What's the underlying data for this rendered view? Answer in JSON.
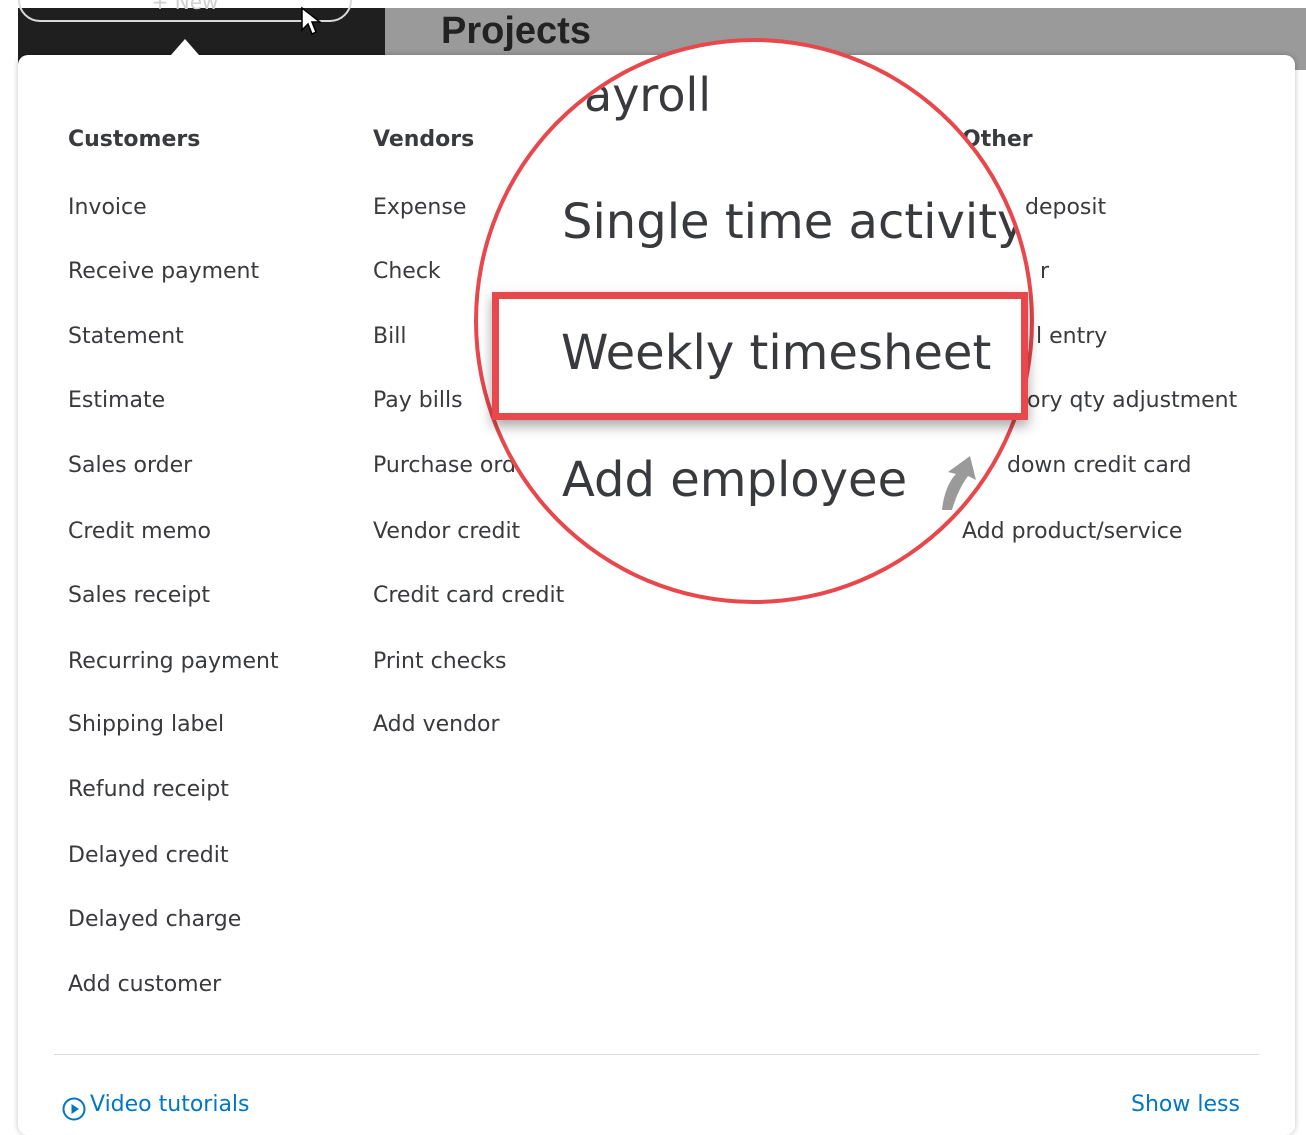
{
  "header": {
    "new_label": "+ New",
    "page_title": "Projects"
  },
  "columns": {
    "customers": {
      "heading": "Customers",
      "items": [
        "Invoice",
        "Receive payment",
        "Statement",
        "Estimate",
        "Sales order",
        "Credit memo",
        "Sales receipt",
        "Recurring payment",
        "Shipping label",
        "Refund receipt",
        "Delayed credit",
        "Delayed charge",
        "Add customer"
      ]
    },
    "vendors": {
      "heading": "Vendors",
      "items": [
        "Expense",
        "Check",
        "Bill",
        "Pay bills",
        "Purchase ord",
        "Vendor credit",
        "Credit card credit",
        "Print checks",
        "Add vendor"
      ]
    },
    "other": {
      "heading": "Other",
      "heading_visible": "Other",
      "items": [
        "deposit",
        "r",
        "l entry",
        "ory qty adjustment",
        "down credit card",
        "Add product/service"
      ]
    }
  },
  "magnifier": {
    "heading": "ayroll",
    "items": [
      "Single time activity",
      "Weekly timesheet",
      "Add employee"
    ],
    "highlighted": "Weekly timesheet"
  },
  "footer": {
    "video_tutorials": "Video tutorials",
    "show_less": "Show less"
  },
  "colors": {
    "highlight_red": "#e8474c",
    "link_blue": "#0077c5",
    "text": "#393a3d"
  }
}
